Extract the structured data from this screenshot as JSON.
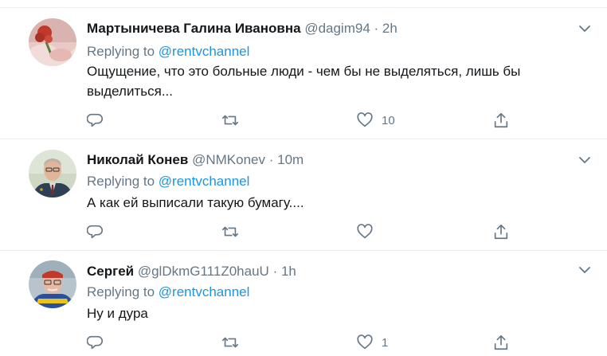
{
  "tweets": [
    {
      "name": "Мартыничева Галина Ивановна",
      "handle": "@dagim94",
      "separator": "·",
      "time": "2h",
      "replying_prefix": "Replying to",
      "replying_to": "@rentvchannel",
      "text": "Ощущение, что это больные люди - чем бы не выделяться, лишь бы выделиться...",
      "likes": "10"
    },
    {
      "name": "Николай Конев",
      "handle": "@NMKonev",
      "separator": "·",
      "time": "10m",
      "replying_prefix": "Replying to",
      "replying_to": "@rentvchannel",
      "text": "А как ей выписали такую бумагу....",
      "likes": ""
    },
    {
      "name": "Сергей",
      "handle": "@glDkmG111Z0hauU",
      "separator": "·",
      "time": "1h",
      "replying_prefix": "Replying to",
      "replying_to": "@rentvchannel",
      "text": "Ну и дура",
      "likes": "1"
    }
  ],
  "icons": {
    "reply": "reply-icon",
    "retweet": "retweet-icon",
    "like": "heart-icon",
    "share": "share-icon",
    "more": "chevron-down-icon"
  },
  "colors": {
    "mention": "#1b95e0",
    "secondary_text": "#657786",
    "divider": "#e6ecf0"
  }
}
